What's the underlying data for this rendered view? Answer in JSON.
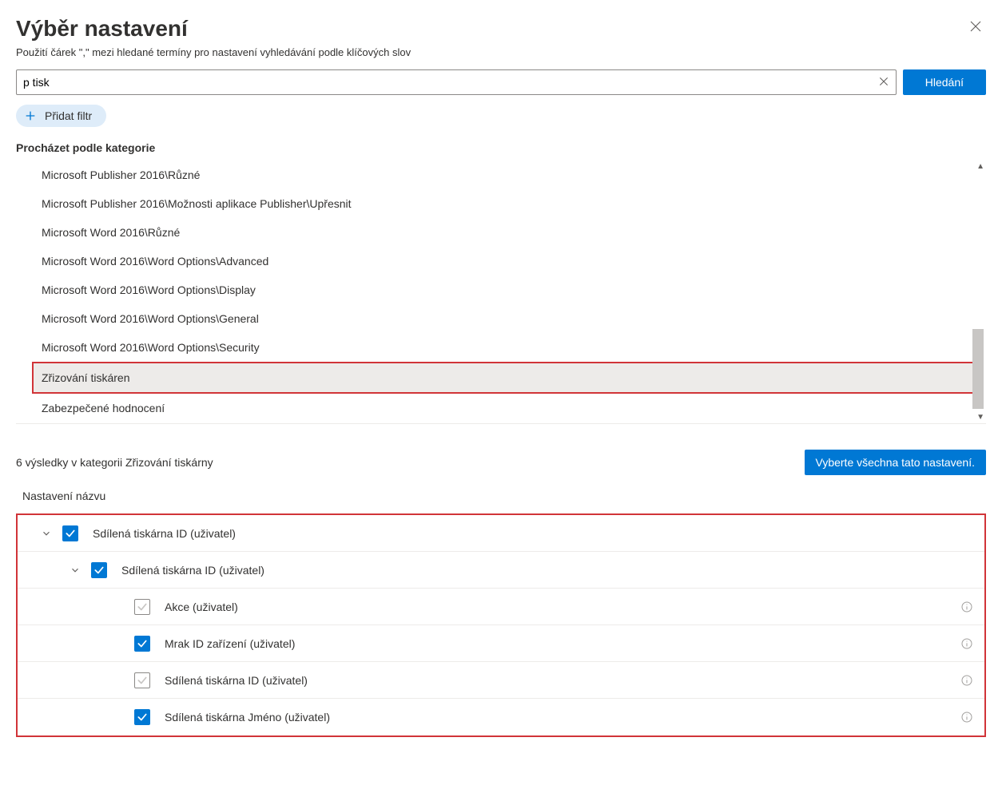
{
  "header": {
    "title": "Výběr nastavení",
    "subtitle": "Použití čárek    \",\"  mezi hledané termíny pro nastavení vyhledávání podle klíčových slov"
  },
  "search": {
    "value": "p tisk",
    "button": "Hledání"
  },
  "addFilter": "Přidat filtr",
  "browseLabel": "Procházet podle kategorie",
  "categories": [
    "Microsoft Publisher 2016\\Různé",
    "Microsoft Publisher 2016\\Možnosti aplikace Publisher\\Upřesnit",
    "Microsoft Word 2016\\Různé",
    "Microsoft Word 2016\\Word Options\\Advanced",
    "Microsoft Word 2016\\Word Options\\Display",
    "Microsoft Word 2016\\Word Options\\General",
    "Microsoft Word 2016\\Word Options\\Security",
    "Zřizování tiskáren",
    "Zabezpečené hodnocení"
  ],
  "selectedCategoryIndex": 7,
  "results": {
    "countText": "6 výsledky v kategorii Zřizování tiskárny",
    "selectAllButton": "Vyberte všechna tato nastavení.",
    "settingsNameLabel": "Nastavení názvu"
  },
  "tree": [
    {
      "level": 0,
      "expandable": true,
      "checked": true,
      "label": "Sdílená tiskárna  ID (uživatel)",
      "info": false
    },
    {
      "level": 1,
      "expandable": true,
      "checked": true,
      "label": "Sdílená tiskárna  ID (uživatel)",
      "info": false
    },
    {
      "level": 2,
      "expandable": false,
      "checked": false,
      "label": "Akce (uživatel)",
      "info": true
    },
    {
      "level": 2,
      "expandable": false,
      "checked": true,
      "label": "Mrak    ID zařízení (uživatel)",
      "info": true
    },
    {
      "level": 2,
      "expandable": false,
      "checked": false,
      "label": "Sdílená tiskárna  ID (uživatel)",
      "info": true
    },
    {
      "level": 2,
      "expandable": false,
      "checked": true,
      "label": "Sdílená tiskárna  Jméno (uživatel)",
      "info": true
    }
  ]
}
